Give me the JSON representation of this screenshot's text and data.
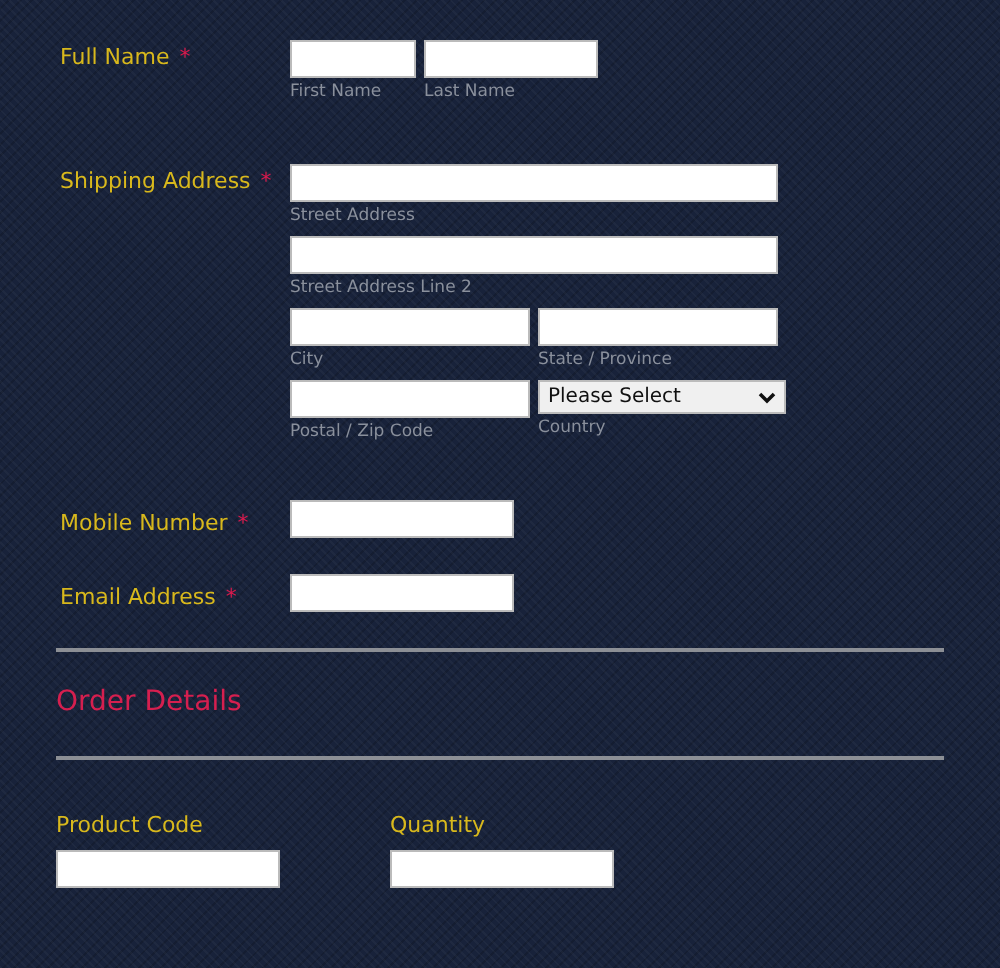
{
  "rows": [
    {
      "kind": "name",
      "label": "Full Name",
      "required_mark": "*",
      "inputs": [
        [
          {
            "kind": "text",
            "sublabel": "First Name"
          },
          {
            "kind": "text",
            "sublabel": "Last Name"
          }
        ]
      ]
    },
    {
      "kind": "address",
      "label": "Shipping Address",
      "required_mark": "*",
      "inputs": [
        [
          {
            "kind": "text",
            "sublabel": "Street Address"
          }
        ],
        [
          {
            "kind": "text",
            "sublabel": "Street Address Line 2"
          }
        ],
        [
          {
            "kind": "text",
            "sublabel": "City"
          },
          {
            "kind": "text",
            "sublabel": "State / Province"
          }
        ],
        [
          {
            "kind": "text",
            "sublabel": "Postal / Zip Code"
          },
          {
            "kind": "select",
            "value": "Please Select",
            "sublabel": "Country"
          }
        ]
      ]
    },
    {
      "kind": "single",
      "label": "Mobile Number",
      "required_mark": "*",
      "inputs": [
        [
          {
            "kind": "text"
          }
        ]
      ]
    },
    {
      "kind": "single",
      "label": "Email Address",
      "required_mark": "*",
      "inputs": [
        [
          {
            "kind": "text"
          }
        ]
      ]
    }
  ],
  "section": {
    "title": "Order Details"
  },
  "order_fields": [
    {
      "label": "Product Code"
    },
    {
      "label": "Quantity"
    }
  ]
}
